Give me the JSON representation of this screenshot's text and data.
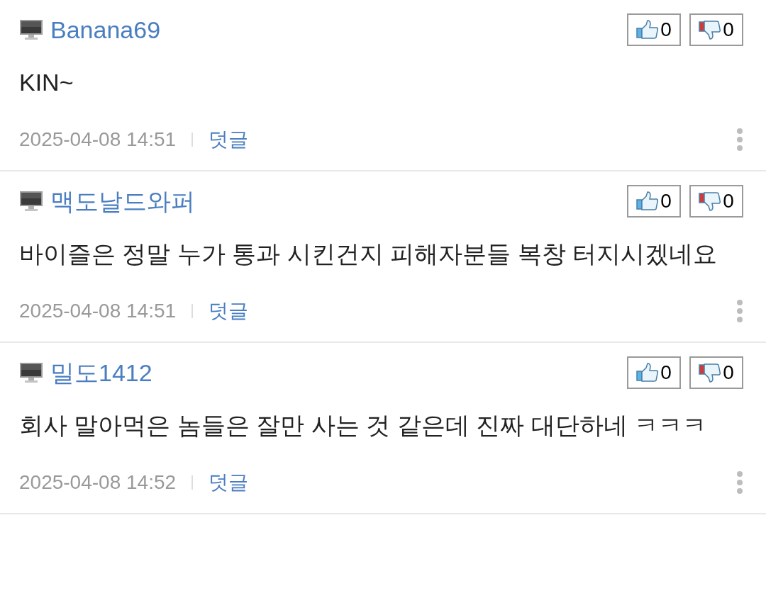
{
  "comments": [
    {
      "author": "Banana69",
      "body": "KIN~",
      "likes": "0",
      "dislikes": "0",
      "time": "2025-04-08 14:51",
      "reply": "덧글"
    },
    {
      "author": "맥도날드와퍼",
      "body": "바이즐은 정말 누가 통과 시킨건지 피해자분들 복창 터지시겠네요",
      "likes": "0",
      "dislikes": "0",
      "time": "2025-04-08 14:51",
      "reply": "덧글"
    },
    {
      "author": "밀도1412",
      "body": "회사 말아먹은 놈들은 잘만 사는 것 같은데 진짜 대단하네 ㅋㅋㅋ",
      "likes": "0",
      "dislikes": "0",
      "time": "2025-04-08 14:52",
      "reply": "덧글"
    }
  ]
}
